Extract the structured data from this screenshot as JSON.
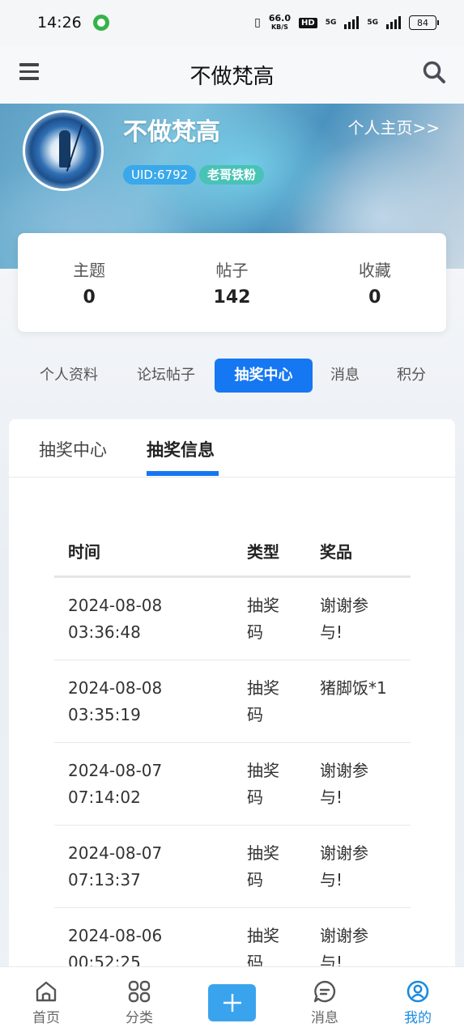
{
  "status_bar": {
    "time": "14:26",
    "speed_value": "66.0",
    "speed_unit": "KB/S",
    "hd_label": "HD",
    "signal1_label": "5G",
    "signal2_label": "5G",
    "battery": "84"
  },
  "header": {
    "title": "不做梵高",
    "menu_icon": "menu-icon",
    "search_icon": "search-icon"
  },
  "profile": {
    "username": "不做梵高",
    "profile_link": "个人主页>>",
    "uid": "UID:6792",
    "fan_badge": "老哥铁粉"
  },
  "stats": [
    {
      "label": "主题",
      "value": "0"
    },
    {
      "label": "帖子",
      "value": "142"
    },
    {
      "label": "收藏",
      "value": "0"
    }
  ],
  "profile_tabs": [
    {
      "label": "个人资料",
      "active": false
    },
    {
      "label": "论坛帖子",
      "active": false
    },
    {
      "label": "抽奖中心",
      "active": true
    },
    {
      "label": "消息",
      "active": false
    },
    {
      "label": "积分",
      "active": false
    }
  ],
  "sub_tabs": [
    {
      "label": "抽奖中心",
      "active": false
    },
    {
      "label": "抽奖信息",
      "active": true
    }
  ],
  "table": {
    "headers": {
      "time": "时间",
      "type": "类型",
      "prize": "奖品"
    },
    "rows": [
      {
        "date": "2024-08-08",
        "clock": "03:36:48",
        "type1": "抽奖",
        "type2": "码",
        "prize1": "谢谢参",
        "prize2": "与!"
      },
      {
        "date": "2024-08-08",
        "clock": "03:35:19",
        "type1": "抽奖",
        "type2": "码",
        "prize1": "猪脚饭*1",
        "prize2": ""
      },
      {
        "date": "2024-08-07",
        "clock": "07:14:02",
        "type1": "抽奖",
        "type2": "码",
        "prize1": "谢谢参",
        "prize2": "与!"
      },
      {
        "date": "2024-08-07",
        "clock": "07:13:37",
        "type1": "抽奖",
        "type2": "码",
        "prize1": "谢谢参",
        "prize2": "与!"
      },
      {
        "date": "2024-08-06",
        "clock": "00:52:25",
        "type1": "抽奖",
        "type2": "码",
        "prize1": "谢谢参",
        "prize2": "与!"
      }
    ]
  },
  "bottom_nav": {
    "home": "首页",
    "category": "分类",
    "messages": "消息",
    "mine": "我的"
  },
  "colors": {
    "accent": "#1677f2",
    "nav_active": "#1a8be0",
    "add_button": "#3aa3ee",
    "uid_badge": "#3aa8ea",
    "fan_badge": "#48c3b6"
  }
}
